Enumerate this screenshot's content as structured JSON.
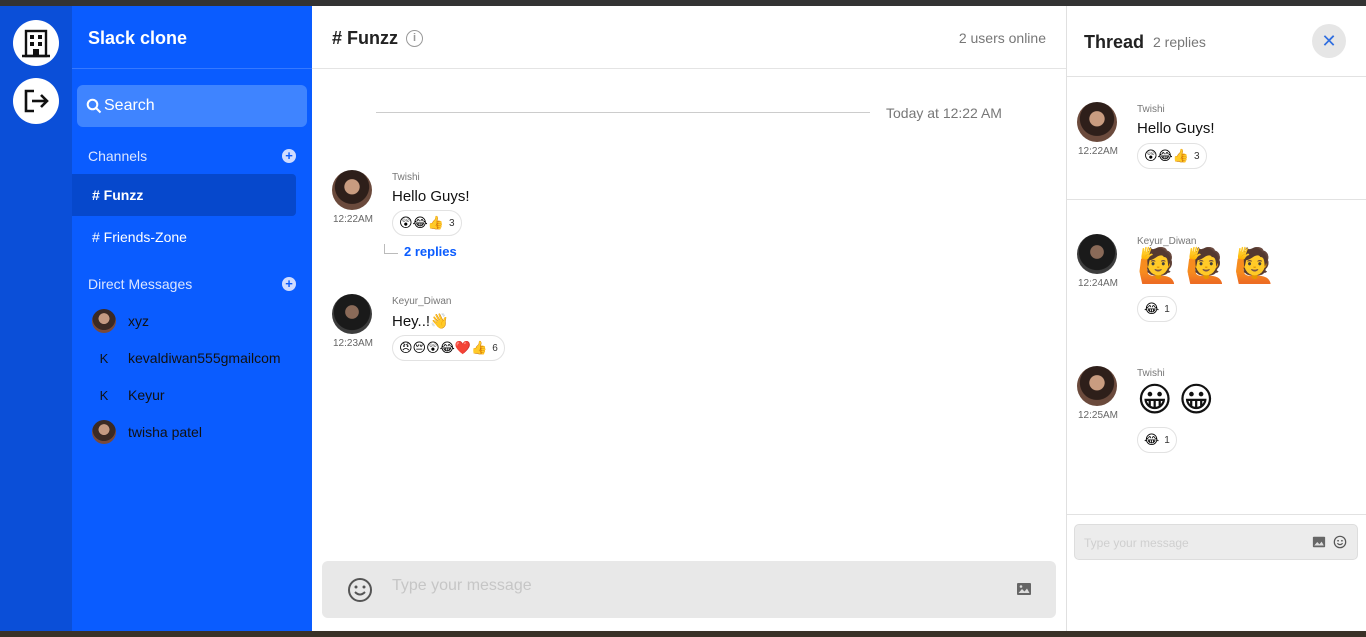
{
  "app": {
    "title": "Slack clone"
  },
  "rail": {
    "icons": [
      "building-icon",
      "logout-icon"
    ]
  },
  "sidebar": {
    "search_placeholder": "Search",
    "channels_label": "Channels",
    "channels": [
      {
        "label": "# Funzz",
        "active": true
      },
      {
        "label": "# Friends-Zone",
        "active": false
      }
    ],
    "dm_label": "Direct Messages",
    "dms": [
      {
        "name": "xyz",
        "avatar": "photo"
      },
      {
        "name": "kevaldiwan555gmailcom",
        "initial": "K"
      },
      {
        "name": "Keyur",
        "initial": "K"
      },
      {
        "name": "twisha patel",
        "avatar": "photo"
      }
    ]
  },
  "channel": {
    "title": "# Funzz",
    "online": "2 users online",
    "date_separator": "Today at 12:22 AM",
    "messages": [
      {
        "user": "Twishi",
        "time": "12:22AM",
        "text": "Hello Guys!",
        "reactions": "😲😂👍",
        "reaction_count": "3",
        "replies": "2 replies"
      },
      {
        "user": "Keyur_Diwan",
        "time": "12:23AM",
        "text": "Hey..!👋",
        "reactions": "😠😔😲😂❤️👍",
        "reaction_count": "6"
      }
    ],
    "composer_placeholder": "Type your message"
  },
  "thread": {
    "title": "Thread",
    "count": "2 replies",
    "messages": [
      {
        "user": "Twishi",
        "time": "12:22AM",
        "text": "Hello Guys!",
        "reactions": "😲😂👍",
        "reaction_count": "3"
      },
      {
        "user": "Keyur_Diwan",
        "time": "12:24AM",
        "text": "🙋🙋🙋",
        "reactions": "😂",
        "reaction_count": "1"
      },
      {
        "user": "Twishi",
        "time": "12:25AM",
        "text": "😀😀",
        "reactions": "😂",
        "reaction_count": "1"
      }
    ],
    "composer_placeholder": "Type your message"
  },
  "colors": {
    "sidebar": "#0a5cff",
    "rail": "#0b4fd8",
    "accent": "#0a5cff"
  }
}
